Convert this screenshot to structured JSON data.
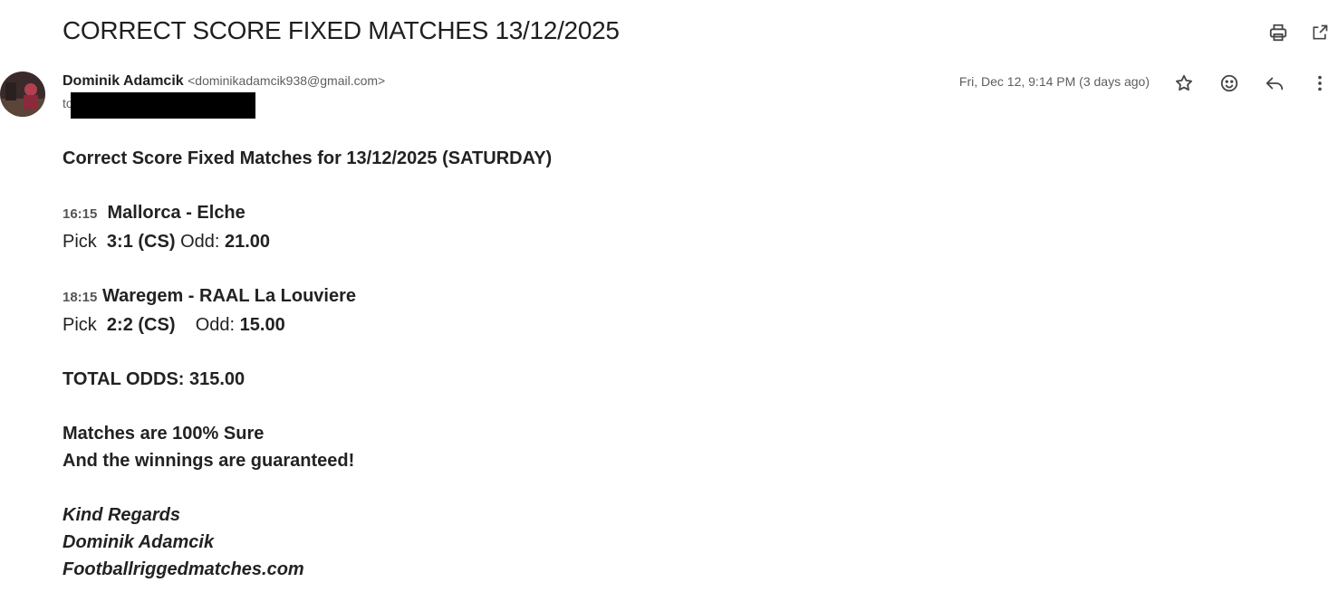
{
  "email": {
    "subject": "CORRECT SCORE FIXED MATCHES 13/12/2025",
    "sender_name": "Dominik Adamcik",
    "sender_email": "<dominikadamcik938@gmail.com>",
    "to_prefix": "to",
    "date": "Fri, Dec 12, 9:14 PM (3 days ago)"
  },
  "icons": {
    "print": "print-icon",
    "open_new_window": "open-in-new-icon",
    "star": "star-icon",
    "emoji": "emoji-icon",
    "reply": "reply-icon",
    "more": "more-vertical-icon"
  },
  "body": {
    "heading": "Correct Score Fixed Matches for 13/12/2025 (SATURDAY)",
    "matches": [
      {
        "time": "16:15",
        "teams": "Mallorca - Elche",
        "pick_label": "Pick",
        "pick": "3:1 (CS)",
        "odd_label": "Odd:",
        "odd": "21.00"
      },
      {
        "time": "18:15",
        "teams": "Waregem - RAAL La Louviere",
        "pick_label": "Pick",
        "pick": "2:2 (CS)",
        "odd_label": "Odd:",
        "odd": "15.00"
      }
    ],
    "total": "TOTAL ODDS: 315.00",
    "sure_line": "Matches are 100% Sure",
    "guarantee_line": "And the winnings are guaranteed!",
    "signature": [
      "Kind Regards",
      "Dominik Adamcik",
      "Footballriggedmatches.com"
    ]
  }
}
